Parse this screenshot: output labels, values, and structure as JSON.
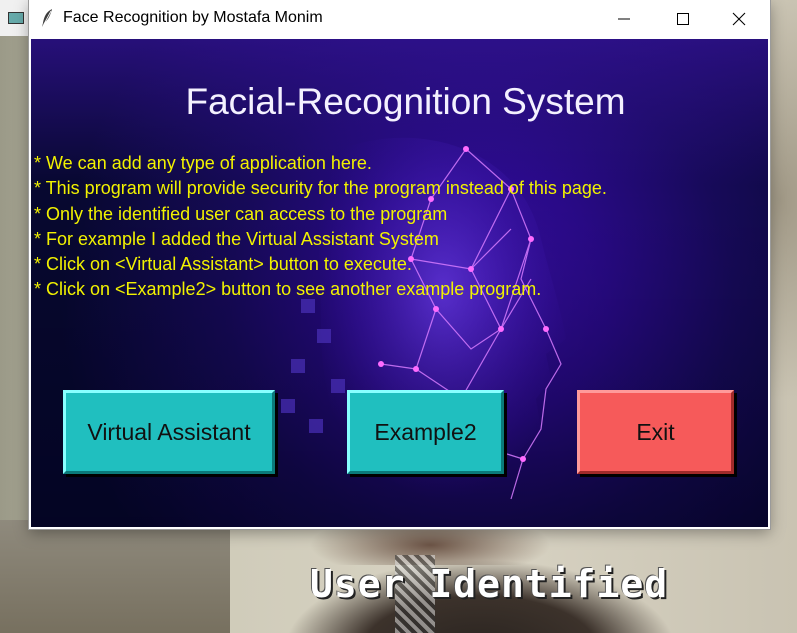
{
  "window": {
    "title": "Face Recognition by Mostafa Monim",
    "controls": {
      "minimize": "minimize-icon",
      "maximize": "maximize-icon",
      "close": "close-icon"
    }
  },
  "canvas": {
    "heading": "Facial-Recognition System",
    "info_lines": [
      "* We can add any type of application here.",
      "* This program will provide security for the program instead of this page.",
      " * Only the identified user can access to the program",
      "* For example I added the Virtual Assistant System",
      "* Click on <Virtual Assistant> button to execute.",
      "* Click on <Example2> button to see another example program."
    ],
    "buttons": {
      "virtual_assistant": "Virtual Assistant",
      "example2": "Example2",
      "exit": "Exit"
    },
    "colors": {
      "info_text": "#f2f200",
      "teal_button": "#20bfbf",
      "exit_button": "#f65a5a"
    }
  },
  "camera": {
    "overlay_text": "User Identified"
  }
}
